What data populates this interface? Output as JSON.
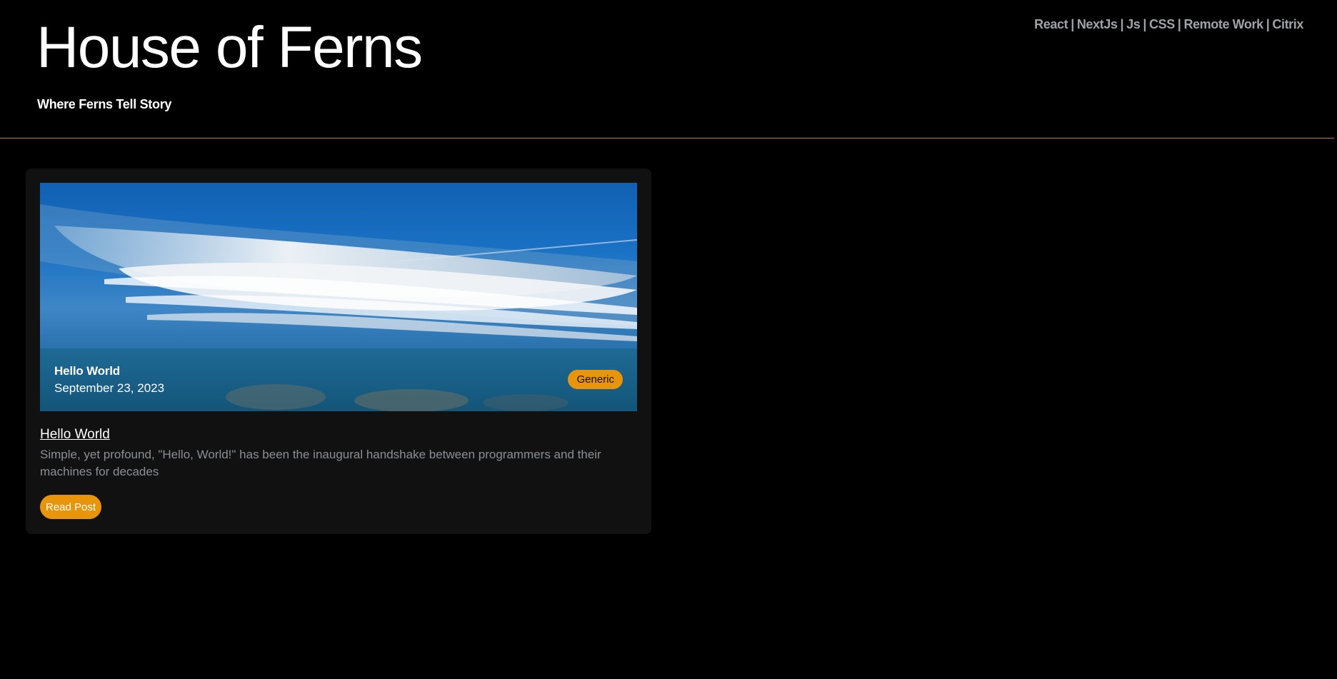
{
  "header": {
    "title": "House of Ferns",
    "tagline": "Where Ferns Tell Story",
    "nav": [
      "React",
      "NextJs",
      "Js",
      "CSS",
      "Remote Work",
      "Citrix"
    ],
    "separator": "|"
  },
  "post": {
    "hero_title": "Hello World",
    "hero_date": "September 23, 2023",
    "category": "Generic",
    "title": "Hello World",
    "excerpt": "Simple, yet profound, \"Hello, World!\" has been the inaugural handshake between programmers and their machines for decades",
    "read_label": "Read Post"
  },
  "colors": {
    "accent": "#e8950c",
    "divider": "#c07f2a",
    "card_bg": "#111111",
    "nav_text": "#9ea3a8",
    "excerpt_text": "#8a8f95"
  }
}
